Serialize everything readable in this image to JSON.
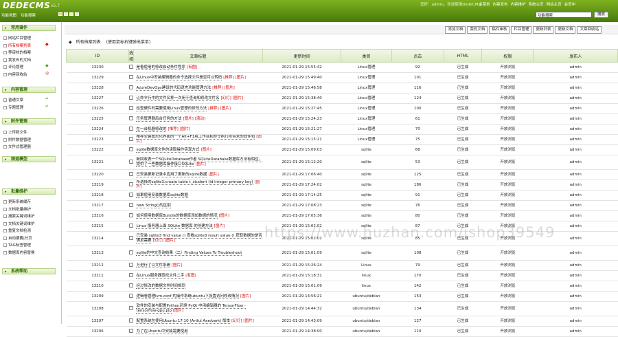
{
  "header": {
    "logo": "DEDECMS",
    "version": "v5.7",
    "user_info": "您好：admin，欢迎使用DedeCMS！",
    "nav": [
      "主菜单",
      "内容发布",
      "内容维护",
      "系统主页",
      "网站主页",
      "会员中"
    ],
    "sublinks": [
      "功能地图",
      "功能搜索"
    ],
    "search_value": "功能搜索",
    "search_button": "搜索"
  },
  "sidebar": {
    "sections": [
      {
        "title": "常用操作",
        "items": [
          "网站栏目管理",
          "所有档案列表",
          "等审核的档案",
          "我发布的文档",
          "评论管理",
          "内容回收站"
        ]
      },
      {
        "title": "内容管理",
        "items": [
          "普通文章",
          "专题管理"
        ]
      },
      {
        "title": "附件管理",
        "items": [
          "上传新文件",
          "附件数据管理",
          "文件式管理器"
        ]
      },
      {
        "title": "频道模型",
        "items": []
      },
      {
        "title": "批量维护",
        "items": [
          "更新系统缓存",
          "文档批量维护",
          "搜索关键词维护",
          "文档关键词维护",
          "重复文档检测",
          "自动摘要|分页",
          "TAG标签管理",
          "数据库内容替换"
        ]
      },
      {
        "title": "系统帮助",
        "items": []
      }
    ]
  },
  "toolbar": {
    "buttons": [
      "添加文档",
      "我的文档",
      "稿件审核",
      "栏目管理",
      "更新列表",
      "更新文档",
      "文章回收站"
    ]
  },
  "list": {
    "title": "所有档案列表",
    "subtitle": "(使用鼠标右键弹出菜单)",
    "columns": [
      "ID",
      "选择",
      "文章标题",
      "更新时间",
      "类目",
      "点击",
      "HTML",
      "权限",
      "发布人"
    ],
    "rows": [
      {
        "id": "13230",
        "title": "是善使用的修改启动条件程序",
        "tags": [
          "[有图]"
        ],
        "time": "2021-01-29 15:55:42",
        "cat": "Linux管理",
        "hits": "92",
        "html": "已生成",
        "perm": "开放浏览",
        "user": "admin"
      },
      {
        "id": "13229",
        "title": "在Linux中安装编辑器的命令选择文件是否可以转码",
        "tags": [
          "[推荐]",
          "[图片]"
        ],
        "time": "2021-01-29 15:49:40",
        "cat": "Linux管理",
        "hits": "101",
        "html": "已生成",
        "perm": "开放浏览",
        "user": "admin"
      },
      {
        "id": "13228",
        "title": "AzureDevOps建设的代码语言功能管理方法",
        "tags": [
          "[推荐]",
          "[图片]"
        ],
        "time": "2021-01-29 15:46:58",
        "cat": "Linux管理",
        "hits": "116",
        "html": "已生成",
        "perm": "开放浏览",
        "user": "admin"
      },
      {
        "id": "13227",
        "title": "让命令行中的文件名称一次用于查询和修改文件名",
        "tags": [
          "[幻灯]",
          "[图片]"
        ],
        "time": "2021-01-29 15:38:40",
        "cat": "Linux管理",
        "hits": "124",
        "html": "已生成",
        "perm": "开放浏览",
        "user": "admin"
      },
      {
        "id": "13226",
        "title": "检查硬件时需要使用Linux管理的修改方法",
        "tags": [
          "[推荐]",
          "[图片]"
        ],
        "time": "2021-01-29 15:27:45",
        "cat": "Linux管理",
        "hits": "100",
        "html": "已生成",
        "perm": "开放浏览",
        "user": "admin"
      },
      {
        "id": "13225",
        "title": "任务管理器后台任务的方法",
        "tags": [
          "[图片]",
          "[滚动]"
        ],
        "time": "2021-01-29 15:24:23",
        "cat": "Linux管理",
        "hits": "61",
        "html": "已生成",
        "perm": "开放浏览",
        "user": "admin"
      },
      {
        "id": "13224",
        "title": "在一台机器修改的",
        "tags": [
          "[推荐]",
          "[图片]"
        ],
        "time": "2021-01-29 15:21:27",
        "cat": "Linux管理",
        "hits": "70",
        "html": "已生成",
        "perm": "开放浏览",
        "user": "admin"
      },
      {
        "id": "13223",
        "title": "推荐安装图形化界面的一个Alt+F1用工作台和命令执行所带来的软件包",
        "tags": [
          "[图片]"
        ],
        "time": "2021-01-29 15:15:21",
        "cat": "Linux管理",
        "hits": "75",
        "html": "已生成",
        "perm": "开放浏览",
        "user": "admin"
      },
      {
        "id": "13222",
        "title": "sqlite数据库文件的读取操作实现方式",
        "tags": [
          "[图片]"
        ],
        "time": "2021-01-29 15:09:03",
        "cat": "sqlite",
        "hits": "68",
        "html": "已生成",
        "perm": "开放浏览",
        "user": "admin"
      },
      {
        "id": "13221",
        "title": "新回收表一个SQLiteDatabase作者 SQLiteDatabase数据库方法有相应，提供了一些数据库操作接口SQLite",
        "tags": [
          "[图片]"
        ],
        "time": "2021-01-29 15:12:20",
        "cat": "sqlite",
        "hits": "53",
        "html": "已生成",
        "perm": "开放浏览",
        "user": "admin"
      },
      {
        "id": "13220",
        "title": "已安装更新记录中应用了更新的sqlite数据",
        "tags": [
          "[图片]"
        ],
        "time": "2021-01-29 17:06:40",
        "cat": "sqlite",
        "hits": "125",
        "html": "已生成",
        "perm": "开放浏览",
        "user": "admin"
      },
      {
        "id": "13219",
        "title": "所选择的sqlite3.create table t_student (id integer primary key)",
        "tags": [
          "[图片]"
        ],
        "time": "2021-01-29 17:24:02",
        "cat": "sqlite",
        "hits": "186",
        "html": "已生成",
        "perm": "开放浏览",
        "user": "admin"
      },
      {
        "id": "13218",
        "title": "如果使用安装数据库sqlite数据",
        "tags": [],
        "time": "2021-01-29 17:14:25",
        "cat": "sqlite",
        "hits": "91",
        "html": "已生成",
        "perm": "开放浏览",
        "user": "admin"
      },
      {
        "id": "13217",
        "title": "new String()的区别",
        "tags": [],
        "time": "2021-01-29 17:08:23",
        "cat": "sqlite",
        "hits": "76",
        "html": "已生成",
        "perm": "开放浏览",
        "user": "admin"
      },
      {
        "id": "13216",
        "title": "如何使用数据库Bundle的数据库添加数据的情况",
        "tags": [
          "[图片]"
        ],
        "time": "2021-01-29 17:05:36",
        "cat": "sqlite",
        "hits": "80",
        "html": "已生成",
        "perm": "开放浏览",
        "user": "admin"
      },
      {
        "id": "13215",
        "title": "Linux 服务器上面 SQLite 数据库 的创建方法",
        "tags": [
          "[图片]"
        ],
        "time": "2021-01-29 15:02:02",
        "cat": "sqlite",
        "hits": "87",
        "html": "已生成",
        "perm": "开放浏览",
        "user": "admin"
      },
      {
        "id": "13214",
        "title": "已安装 sqlite3 find value () 查看sqlite3 result value () 获取数据的是否满足需要",
        "tags": [
          "[幻灯]",
          "[图片]"
        ],
        "time": "2021-01-29 15:02:02",
        "cat": "sqlite",
        "hits": "85",
        "html": "已生成",
        "perm": "开放浏览",
        "user": "admin"
      },
      {
        "id": "13213",
        "title": "sqlite的中文查询结果（二）Finding Values To Troubleshoot",
        "tags": [],
        "time": "2021-01-29 15:01:09",
        "cat": "sqlite",
        "hits": "108",
        "html": "已生成",
        "perm": "开放浏览",
        "user": "admin"
      },
      {
        "id": "13212",
        "title": "万进行了以文件系统",
        "tags": [
          "[图片]"
        ],
        "time": "2021-01-29 15:26:24",
        "cat": "Linux",
        "hits": "79",
        "html": "已生成",
        "perm": "开放浏览",
        "user": "admin"
      },
      {
        "id": "13211",
        "title": "在Linux服务器查找文件二手",
        "tags": [
          "[有图]"
        ],
        "time": "2021-01-29 15:18:31",
        "cat": "linux",
        "hits": "170",
        "html": "已生成",
        "perm": "开放浏览",
        "user": "admin"
      },
      {
        "id": "13210",
        "title": "经过修改的数据文件时间相同",
        "tags": [],
        "time": "2021-01-29 15:01:09",
        "cat": "linux",
        "hits": "142",
        "html": "已生成",
        "perm": "开放浏览",
        "user": "admin"
      },
      {
        "id": "13209",
        "title": "逻辑卷管理lvm.conf 的操作系统ubuntu下设置访问修改情况",
        "tags": [
          "[图片]"
        ],
        "time": "2021-01-29 14:56:21",
        "cat": "ubuntu/debian",
        "hits": "153",
        "html": "已生成",
        "perm": "开放浏览",
        "user": "admin"
      },
      {
        "id": "13208",
        "title": "软件的安装与配置Python环境 PyQt 中用编辑器的 TensorFlow - tensorflow-gpu.pip",
        "tags": [
          "[图片]"
        ],
        "time": "2021-01-29 14:44:32",
        "cat": "ubuntu/debian",
        "hits": "134",
        "html": "已生成",
        "perm": "开放浏览",
        "user": "admin"
      },
      {
        "id": "13207",
        "title": "配置系统在使用Ubuntu 17.10 (Artful Aardvark) 版本",
        "tags": [
          "[幻灯]",
          "[图片]"
        ],
        "time": "2021-01-29 14:43:09",
        "cat": "ubuntu/debian",
        "hits": "127",
        "html": "已生成",
        "perm": "开放浏览",
        "user": "admin"
      },
      {
        "id": "13206",
        "title": "为了在Ubuntu中安装需要使用",
        "tags": [],
        "time": "2021-01-29 14:38:00",
        "cat": "ubuntu/debian",
        "hits": "110",
        "html": "已生成",
        "perm": "开放浏览",
        "user": "admin"
      }
    ]
  },
  "watermark": "https://www.huzhan.com/ishop39549"
}
